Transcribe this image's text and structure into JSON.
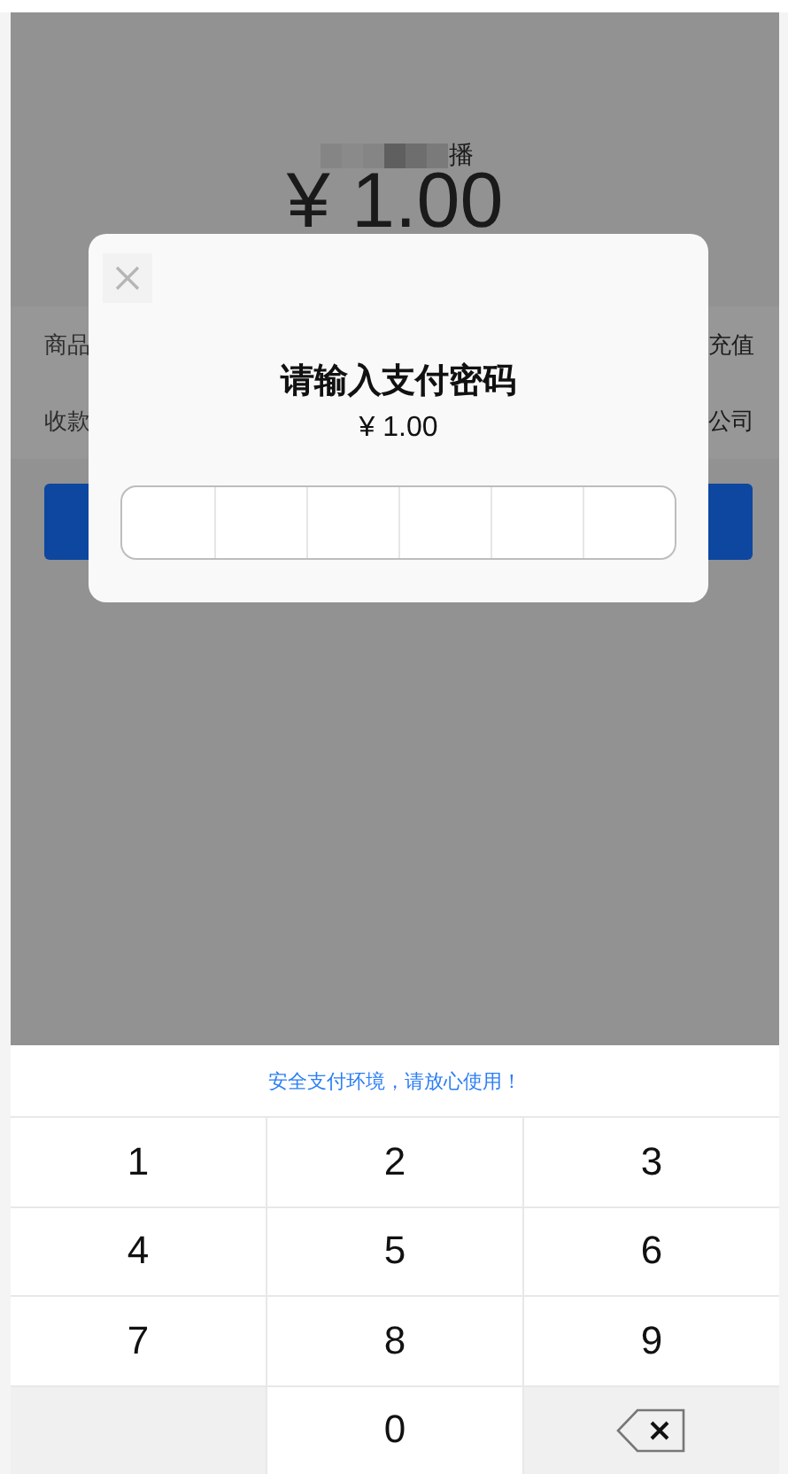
{
  "page": {
    "merchant": "播",
    "amount": "¥ 1.00",
    "rows": [
      {
        "label": "商品",
        "value": "充值"
      },
      {
        "label": "收款",
        "value": "公司"
      }
    ]
  },
  "dialog": {
    "title": "请输入支付密码",
    "amount": "¥ 1.00"
  },
  "keyboard": {
    "notice": "安全支付环境，请放心使用！",
    "keys": [
      {
        "kind": "digit",
        "label": "1"
      },
      {
        "kind": "digit",
        "label": "2"
      },
      {
        "kind": "digit",
        "label": "3"
      },
      {
        "kind": "digit",
        "label": "4"
      },
      {
        "kind": "digit",
        "label": "5"
      },
      {
        "kind": "digit",
        "label": "6"
      },
      {
        "kind": "digit",
        "label": "7"
      },
      {
        "kind": "digit",
        "label": "8"
      },
      {
        "kind": "digit",
        "label": "9"
      },
      {
        "kind": "blank"
      },
      {
        "kind": "digit",
        "label": "0"
      },
      {
        "kind": "delete"
      }
    ]
  }
}
